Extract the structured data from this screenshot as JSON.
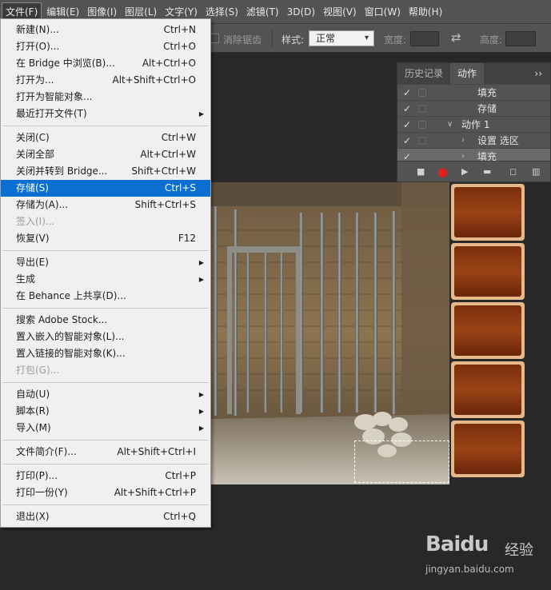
{
  "menubar": {
    "items": [
      "文件(F)",
      "编辑(E)",
      "图像(I)",
      "图层(L)",
      "文字(Y)",
      "选择(S)",
      "滤镜(T)",
      "3D(D)",
      "视图(V)",
      "窗口(W)",
      "帮助(H)"
    ]
  },
  "options_bar": {
    "antialias_label": "消除锯齿",
    "style_label": "样式:",
    "style_value": "正常",
    "width_label": "宽度:",
    "height_label": "高度:"
  },
  "panel": {
    "tab_history": "历史记录",
    "tab_actions": "动作",
    "more": "››",
    "rows": [
      {
        "label": "填充",
        "indent": 2,
        "arrow": ""
      },
      {
        "label": "存储",
        "indent": 2,
        "arrow": ""
      },
      {
        "label": "动作 1",
        "indent": 1,
        "arrow": "∨"
      },
      {
        "label": "设置 选区",
        "indent": 2,
        "arrow": "›"
      },
      {
        "label": "填充",
        "indent": 2,
        "arrow": "›"
      }
    ]
  },
  "file_menu": {
    "groups": [
      [
        {
          "label": "新建(N)...",
          "shortcut": "Ctrl+N"
        },
        {
          "label": "打开(O)...",
          "shortcut": "Ctrl+O"
        },
        {
          "label": "在 Bridge 中浏览(B)...",
          "shortcut": "Alt+Ctrl+O"
        },
        {
          "label": "打开为...",
          "shortcut": "Alt+Shift+Ctrl+O"
        },
        {
          "label": "打开为智能对象...",
          "shortcut": ""
        },
        {
          "label": "最近打开文件(T)",
          "shortcut": "",
          "submenu": true
        }
      ],
      [
        {
          "label": "关闭(C)",
          "shortcut": "Ctrl+W"
        },
        {
          "label": "关闭全部",
          "shortcut": "Alt+Ctrl+W"
        },
        {
          "label": "关闭并转到 Bridge...",
          "shortcut": "Shift+Ctrl+W"
        },
        {
          "label": "存储(S)",
          "shortcut": "Ctrl+S",
          "highlight": true
        },
        {
          "label": "存储为(A)...",
          "shortcut": "Shift+Ctrl+S"
        },
        {
          "label": "签入(I)...",
          "shortcut": "",
          "disabled": true
        },
        {
          "label": "恢复(V)",
          "shortcut": "F12"
        }
      ],
      [
        {
          "label": "导出(E)",
          "shortcut": "",
          "submenu": true
        },
        {
          "label": "生成",
          "shortcut": "",
          "submenu": true
        },
        {
          "label": "在 Behance 上共享(D)...",
          "shortcut": ""
        }
      ],
      [
        {
          "label": "搜索 Adobe Stock...",
          "shortcut": ""
        },
        {
          "label": "置入嵌入的智能对象(L)...",
          "shortcut": ""
        },
        {
          "label": "置入链接的智能对象(K)...",
          "shortcut": ""
        },
        {
          "label": "打包(G)...",
          "shortcut": "",
          "disabled": true
        }
      ],
      [
        {
          "label": "自动(U)",
          "shortcut": "",
          "submenu": true
        },
        {
          "label": "脚本(R)",
          "shortcut": "",
          "submenu": true
        },
        {
          "label": "导入(M)",
          "shortcut": "",
          "submenu": true
        }
      ],
      [
        {
          "label": "文件简介(F)...",
          "shortcut": "Alt+Shift+Ctrl+I"
        }
      ],
      [
        {
          "label": "打印(P)...",
          "shortcut": "Ctrl+P"
        },
        {
          "label": "打印一份(Y)",
          "shortcut": "Alt+Shift+Ctrl+P"
        }
      ],
      [
        {
          "label": "退出(X)",
          "shortcut": "Ctrl+Q"
        }
      ]
    ]
  },
  "watermark": {
    "brand": "Baidu",
    "jingyan": "经验",
    "url": "jingyan.baidu.com"
  }
}
